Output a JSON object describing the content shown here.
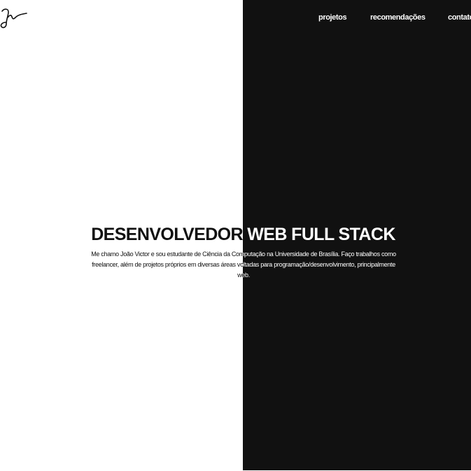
{
  "logo": {
    "icon": "signature-logo-icon"
  },
  "nav": {
    "items": [
      {
        "label": "projetos"
      },
      {
        "label": "recomendações"
      },
      {
        "label": "contato"
      }
    ]
  },
  "hero": {
    "title": "DESENVOLVEDOR WEB FULL STACK",
    "description": "Me chamo João Victor e sou estudante de Ciência da Computação na Universidade de Brasília. Faço trabalhos como freelancer, além de projetos próprios em diversas áreas voltadas para programação/desenvolvimento, principalmente web."
  },
  "colors": {
    "background_light": "#ffffff",
    "background_dark": "#111111",
    "text_dark": "#111111",
    "text_light": "#ffffff"
  }
}
